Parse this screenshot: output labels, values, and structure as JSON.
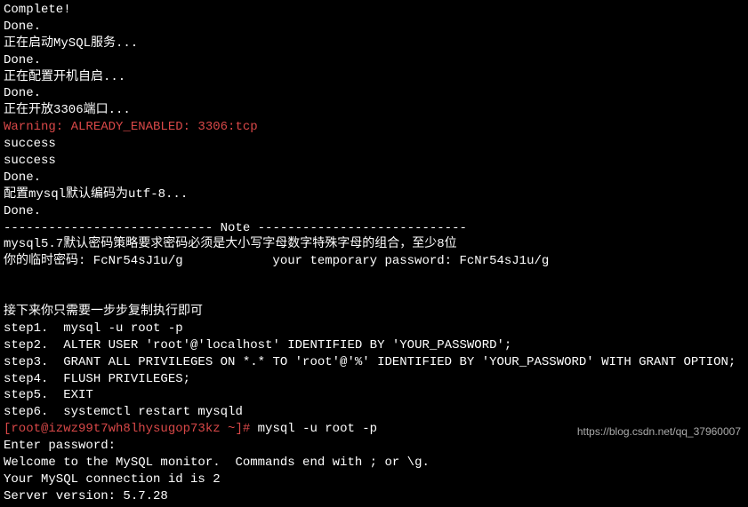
{
  "lines": [
    {
      "cls": "",
      "text": "Complete!"
    },
    {
      "cls": "",
      "text": "Done."
    },
    {
      "cls": "",
      "text": "正在启动MySQL服务..."
    },
    {
      "cls": "",
      "text": "Done."
    },
    {
      "cls": "",
      "text": "正在配置开机自启..."
    },
    {
      "cls": "",
      "text": "Done."
    },
    {
      "cls": "",
      "text": "正在开放3306端口..."
    },
    {
      "cls": "warn",
      "text": "Warning: ALREADY_ENABLED: 3306:tcp"
    },
    {
      "cls": "",
      "text": "success"
    },
    {
      "cls": "",
      "text": "success"
    },
    {
      "cls": "",
      "text": "Done."
    },
    {
      "cls": "",
      "text": "配置mysql默认编码为utf-8..."
    },
    {
      "cls": "",
      "text": "Done."
    },
    {
      "cls": "",
      "text": "---------------------------- Note ----------------------------"
    },
    {
      "cls": "",
      "text": "mysql5.7默认密码策略要求密码必须是大小写字母数字特殊字母的组合，至少8位"
    },
    {
      "cls": "",
      "text": "你的临时密码: FcNr54sJ1u/g            your temporary password: FcNr54sJ1u/g"
    },
    {
      "cls": "",
      "text": ""
    },
    {
      "cls": "",
      "text": ""
    },
    {
      "cls": "",
      "text": "接下来你只需要一步步复制执行即可"
    },
    {
      "cls": "",
      "text": "step1.  mysql -u root -p"
    },
    {
      "cls": "",
      "text": "step2.  ALTER USER 'root'@'localhost' IDENTIFIED BY 'YOUR_PASSWORD';"
    },
    {
      "cls": "",
      "text": "step3.  GRANT ALL PRIVILEGES ON *.* TO 'root'@'%' IDENTIFIED BY 'YOUR_PASSWORD' WITH GRANT OPTION;"
    },
    {
      "cls": "",
      "text": "step4.  FLUSH PRIVILEGES;"
    },
    {
      "cls": "",
      "text": "step5.  EXIT"
    },
    {
      "cls": "",
      "text": "step6.  systemctl restart mysqld"
    }
  ],
  "prompt": {
    "user": "[root@izwz99t7wh8lhysugop73kz ~]# ",
    "cmd": "mysql -u root -p"
  },
  "after": [
    "Enter password:",
    "Welcome to the MySQL monitor.  Commands end with ; or \\g.",
    "Your MySQL connection id is 2",
    "Server version: 5.7.28"
  ],
  "watermark": "https://blog.csdn.net/qq_37960007"
}
